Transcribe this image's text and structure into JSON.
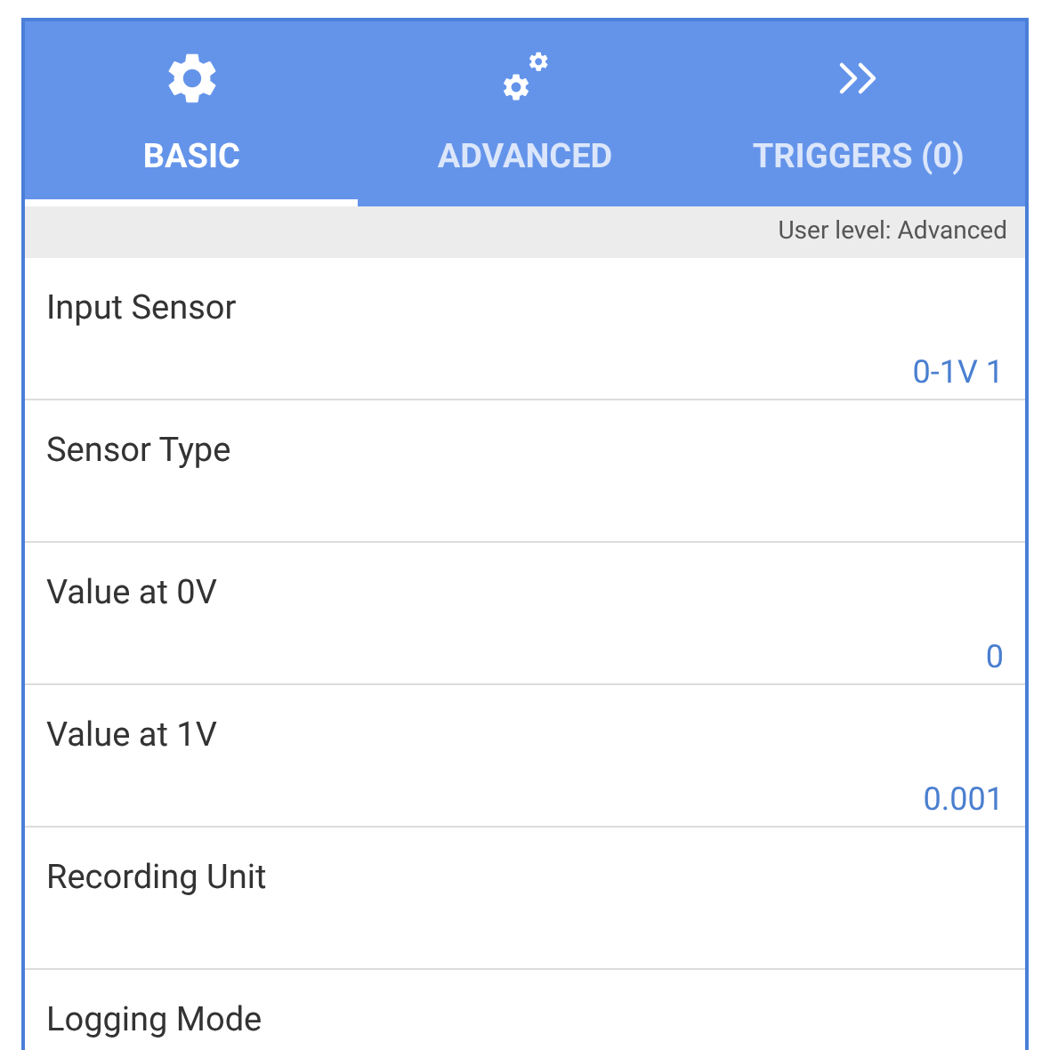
{
  "tabs": [
    {
      "label": "BASIC",
      "kind": "gear",
      "selected": true
    },
    {
      "label": "ADVANCED",
      "kind": "gears",
      "selected": false
    },
    {
      "label": "TRIGGERS (0)",
      "kind": "chevrons",
      "selected": false
    }
  ],
  "user_level": "User level: Advanced",
  "settings": [
    {
      "label": "Input Sensor",
      "value": "0-1V 1"
    },
    {
      "label": "Sensor Type"
    },
    {
      "label": "Value at 0V",
      "value": "0"
    },
    {
      "label": "Value at 1V",
      "value": "0.001"
    },
    {
      "label": "Recording Unit"
    },
    {
      "label": "Logging Mode"
    }
  ]
}
